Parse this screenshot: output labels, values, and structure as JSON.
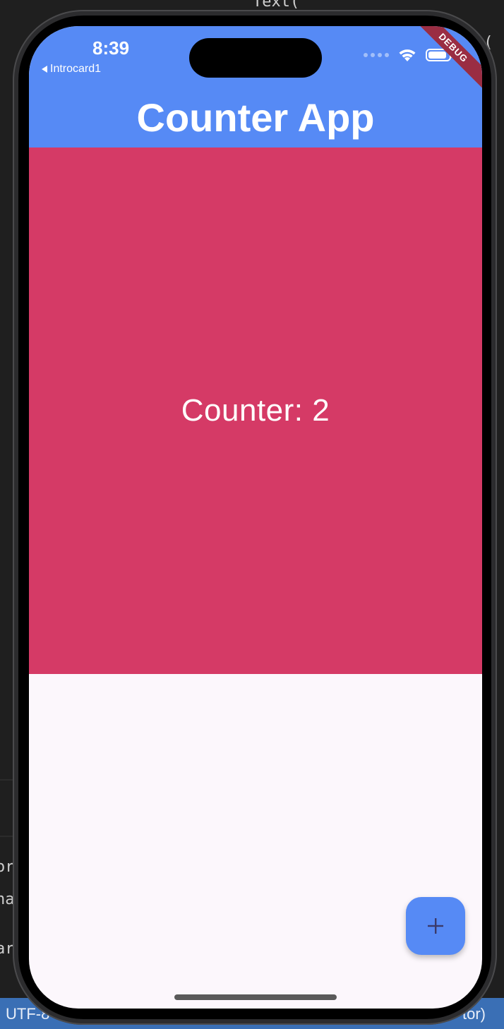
{
  "editor": {
    "fragment_top": "Text(",
    "fragment_right_1": "e(",
    "fragment_left_1": "ord",
    "fragment_left_2": "nal",
    "fragment_left_3": "ar"
  },
  "statusbar": {
    "encoding": "UTF-8",
    "right_text": "tor)"
  },
  "device": {
    "time": "8:39",
    "back_label": "Introcard1",
    "battery_level": 0.9,
    "debug_banner": "DEBUG"
  },
  "app": {
    "title": "Counter App",
    "counter_text": "Counter: 2",
    "fab_icon": "plus-icon"
  },
  "colors": {
    "appbar": "#568af5",
    "counter_panel": "#d53a66",
    "body": "#fcf7fc",
    "fab": "#568af5",
    "fab_icon": "#3b3a6a"
  }
}
